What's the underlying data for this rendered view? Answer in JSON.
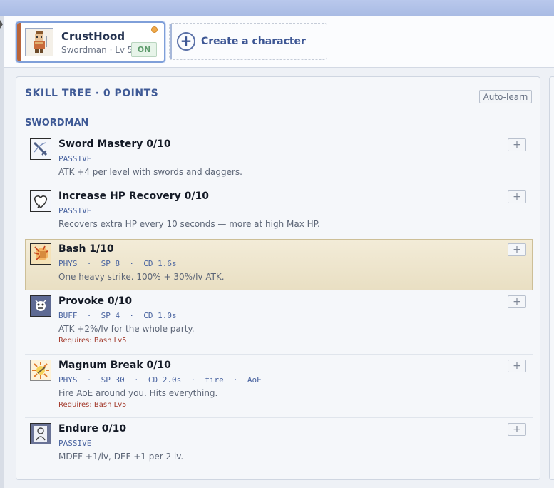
{
  "character": {
    "name": "CrustHood",
    "class_level": "Swordman · Lv 5",
    "status": "ON"
  },
  "create_character": {
    "plus": "+",
    "label": "Create a character"
  },
  "skill_tree": {
    "title": "SKILL TREE · 0 POINTS",
    "auto_learn_label": "Auto-learn",
    "section": "SWORDMAN",
    "skills": [
      {
        "name": "Sword Mastery 0/10",
        "meta": "PASSIVE",
        "desc": "ATK +4 per level with swords and daggers.",
        "icon": "sword-mastery-icon"
      },
      {
        "name": "Increase HP Recovery 0/10",
        "meta": "PASSIVE",
        "desc": "Recovers extra HP every 10 seconds — more at high Max HP.",
        "icon": "heart-recovery-icon"
      },
      {
        "name": "Bash 1/10",
        "meta": "PHYS  ·  SP 8  ·  CD 1.6s",
        "desc": "One heavy strike. 100% + 30%/lv ATK.",
        "icon": "bash-icon"
      },
      {
        "name": "Provoke 0/10",
        "meta": "BUFF  ·  SP 4  ·  CD 1.0s",
        "desc": "ATK +2%/lv for the whole party.",
        "requires": "Requires: Bash Lv5",
        "icon": "provoke-icon"
      },
      {
        "name": "Magnum Break 0/10",
        "meta": "PHYS  ·  SP 30  ·  CD 2.0s  ·  fire  ·  AoE",
        "desc": "Fire AoE around you. Hits everything.",
        "requires": "Requires: Bash Lv5",
        "icon": "magnum-break-icon"
      },
      {
        "name": "Endure 0/10",
        "meta": "PASSIVE",
        "desc": "MDEF +1/lv, DEF +1 per 2 lv.",
        "icon": "endure-icon"
      }
    ],
    "plus_label": "+"
  },
  "colors": {
    "accent": "#3f5a96",
    "active_row": "#efe6cc",
    "requirement": "#a33a2c"
  }
}
